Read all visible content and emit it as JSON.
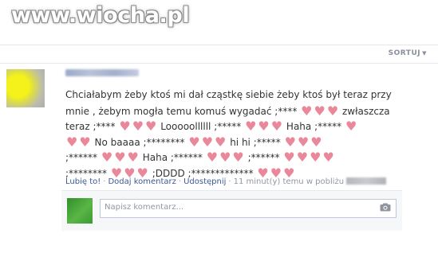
{
  "watermark": {
    "text": "www.wiocha.pl"
  },
  "header": {
    "sort_label": "SORTUJ"
  },
  "post": {
    "lines": [
      [
        {
          "t": "Chciałabym żeby ktoś mi dał cząstkę siebie żeby ktoś był teraz przy"
        }
      ],
      [
        {
          "t": "mnie , żebym mogła temu komuś wygadać ;****"
        },
        {
          "h": 3
        },
        {
          "t": "zwłaszcza"
        }
      ],
      [
        {
          "t": "teraz ;****"
        },
        {
          "h": 3
        },
        {
          "t": "Looooollllll ;*****"
        },
        {
          "h": 3
        },
        {
          "t": "Haha ;*****"
        },
        {
          "h": 1
        }
      ],
      [
        {
          "h": 2
        },
        {
          "t": "No baaaa ;********"
        },
        {
          "h": 3
        },
        {
          "t": "hi hi ;*****"
        },
        {
          "h": 3
        }
      ],
      [
        {
          "t": ";******"
        },
        {
          "h": 3
        },
        {
          "t": "Haha ;******"
        },
        {
          "h": 3
        },
        {
          "t": ";******"
        },
        {
          "h": 4
        }
      ],
      [
        {
          "t": ";********"
        },
        {
          "h": 3
        },
        {
          "t": ";DDDD ;*************"
        },
        {
          "h": 3
        }
      ]
    ],
    "heart_color": "#e9889a"
  },
  "actions": {
    "like": "Lubię to!",
    "comment": "Dodaj komentarz",
    "share": "Udostępnij",
    "time": "11 minut(y) temu w pobliżu"
  },
  "comment": {
    "placeholder": "Napisz komentarz..."
  },
  "icons": {
    "camera": "camera-icon"
  }
}
